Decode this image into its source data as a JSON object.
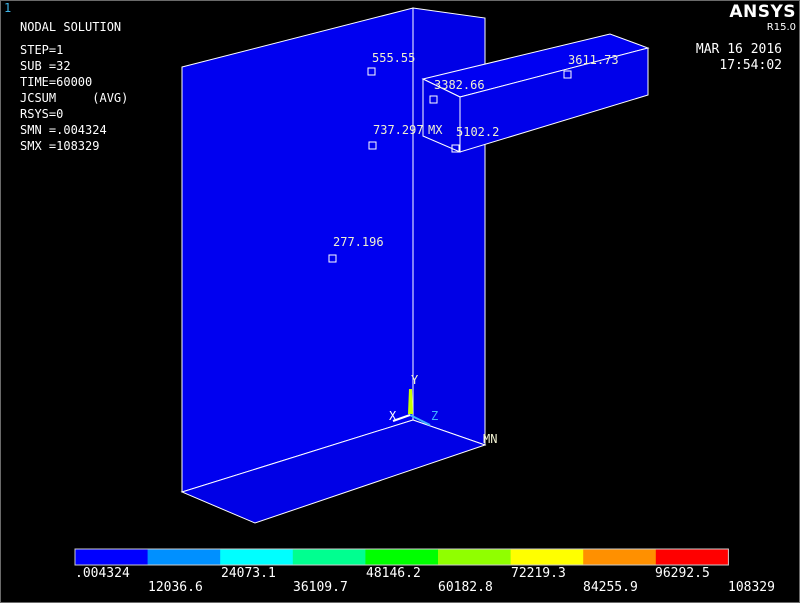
{
  "window_number": "1",
  "header": {
    "title": "NODAL SOLUTION",
    "step": "STEP=1",
    "sub": "SUB =32",
    "time": "TIME=60000",
    "result": "JCSUM     (AVG)",
    "rsys": "RSYS=0",
    "smn": "SMN =.004324",
    "smx": "SMX =108329"
  },
  "brand": {
    "name": "ANSYS",
    "version": "R15.0"
  },
  "timestamp": {
    "date": "MAR 16 2016",
    "time": "17:54:02"
  },
  "probes": [
    {
      "value": "555.55"
    },
    {
      "value": "3382.66"
    },
    {
      "value": "3611.73"
    },
    {
      "value": "737.297"
    },
    {
      "value": "5102.2"
    },
    {
      "value": "277.196"
    }
  ],
  "markers": {
    "mx": "MX",
    "mn": "MN"
  },
  "triad": {
    "x": "X",
    "y": "Y",
    "z": "Z"
  },
  "legend": {
    "colors": [
      "#0000ff",
      "#0090ff",
      "#00ffff",
      "#00ff90",
      "#00ff00",
      "#90ff00",
      "#ffff00",
      "#ff9000",
      "#ff0000"
    ],
    "top_labels": [
      ".004324",
      "24073.1",
      "48146.2",
      "72219.3",
      "96292.5"
    ],
    "bottom_labels": [
      "12036.6",
      "36109.7",
      "60182.8",
      "84255.9",
      "108329"
    ]
  }
}
